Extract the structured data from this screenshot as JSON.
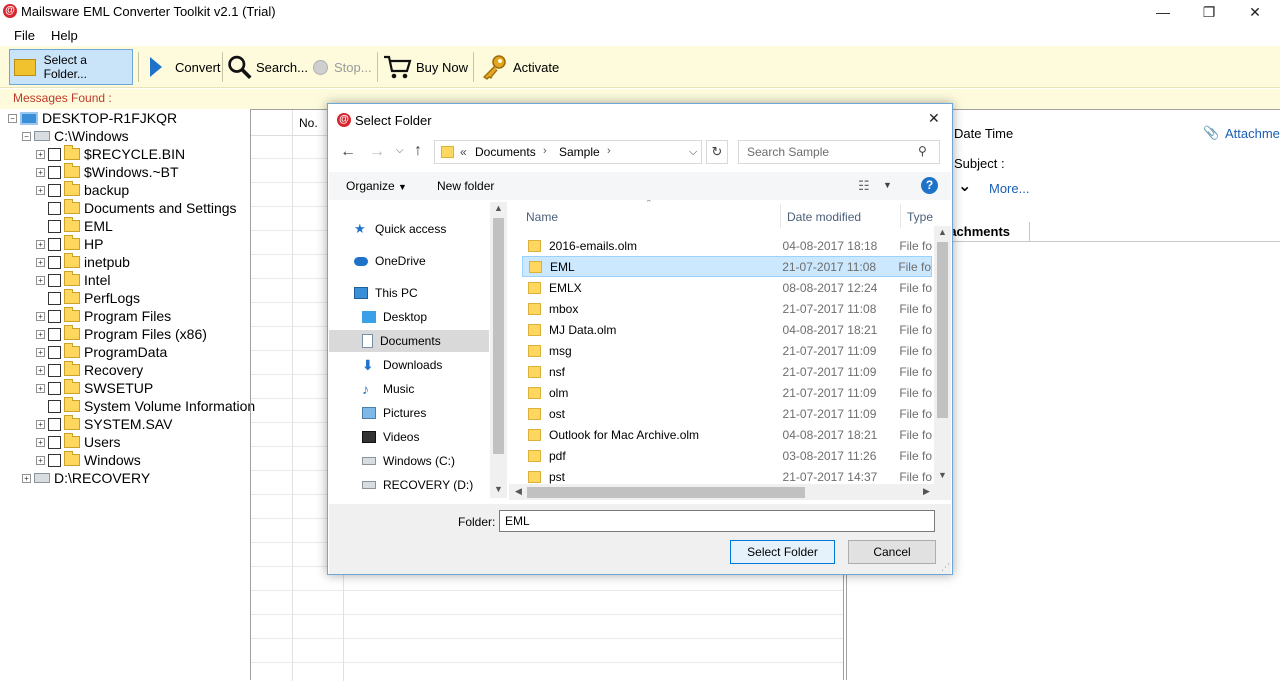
{
  "window": {
    "title": "Mailsware EML Converter Toolkit v2.1 (Trial)",
    "logo_glyph": "@",
    "minimize": "—",
    "maximize": "❐",
    "close": "✕"
  },
  "menu": {
    "file": "File",
    "help": "Help"
  },
  "toolbar": {
    "select_folder": "Select a Folder...",
    "convert": "Convert",
    "search": "Search...",
    "stop": "Stop...",
    "buy_now": "Buy Now",
    "activate": "Activate"
  },
  "messages_found": "Messages Found :",
  "tree": {
    "root": "DESKTOP-R1FJKQR",
    "drive_c": "C:\\Windows",
    "folders": [
      {
        "label": "$RECYCLE.BIN",
        "expandable": true
      },
      {
        "label": "$Windows.~BT",
        "expandable": true
      },
      {
        "label": "backup",
        "expandable": true
      },
      {
        "label": "Documents and Settings",
        "expandable": false
      },
      {
        "label": "EML",
        "expandable": false
      },
      {
        "label": "HP",
        "expandable": true
      },
      {
        "label": "inetpub",
        "expandable": true
      },
      {
        "label": "Intel",
        "expandable": true
      },
      {
        "label": "PerfLogs",
        "expandable": false
      },
      {
        "label": "Program Files",
        "expandable": true
      },
      {
        "label": "Program Files (x86)",
        "expandable": true
      },
      {
        "label": "ProgramData",
        "expandable": true
      },
      {
        "label": "Recovery",
        "expandable": true
      },
      {
        "label": "SWSETUP",
        "expandable": true
      },
      {
        "label": "System Volume Information",
        "expandable": false
      },
      {
        "label": "SYSTEM.SAV",
        "expandable": true
      },
      {
        "label": "Users",
        "expandable": true
      },
      {
        "label": "Windows",
        "expandable": true
      }
    ],
    "drive_d": "D:\\RECOVERY"
  },
  "grid": {
    "col_no": "No."
  },
  "preview": {
    "date_time": "Date Time",
    "attachments_short": "Attachme",
    "subject": "Subject :",
    "more": "More...",
    "attachments_tab": "tachments"
  },
  "dialog": {
    "title": "Select Folder",
    "breadcrumb_prefix": "«",
    "breadcrumb_1": "Documents",
    "breadcrumb_2": "Sample",
    "search_placeholder": "Search Sample",
    "organize": "Organize",
    "new_folder": "New folder",
    "help": "?",
    "nav": {
      "quick_access": "Quick access",
      "onedrive": "OneDrive",
      "this_pc": "This PC",
      "desktop": "Desktop",
      "documents": "Documents",
      "downloads": "Downloads",
      "music": "Music",
      "pictures": "Pictures",
      "videos": "Videos",
      "windows_c": "Windows (C:)",
      "recovery_d": "RECOVERY (D:)"
    },
    "columns": {
      "name": "Name",
      "date_modified": "Date modified",
      "type": "Type"
    },
    "files": [
      {
        "name": "2016-emails.olm",
        "date": "04-08-2017 18:18",
        "type": "File fo"
      },
      {
        "name": "EML",
        "date": "21-07-2017 11:08",
        "type": "File fo",
        "selected": true
      },
      {
        "name": "EMLX",
        "date": "08-08-2017 12:24",
        "type": "File fo"
      },
      {
        "name": "mbox",
        "date": "21-07-2017 11:08",
        "type": "File fo"
      },
      {
        "name": "MJ Data.olm",
        "date": "04-08-2017 18:21",
        "type": "File fo"
      },
      {
        "name": "msg",
        "date": "21-07-2017 11:09",
        "type": "File fo"
      },
      {
        "name": "nsf",
        "date": "21-07-2017 11:09",
        "type": "File fo"
      },
      {
        "name": "olm",
        "date": "21-07-2017 11:09",
        "type": "File fo"
      },
      {
        "name": "ost",
        "date": "21-07-2017 11:09",
        "type": "File fo"
      },
      {
        "name": "Outlook for Mac Archive.olm",
        "date": "04-08-2017 18:21",
        "type": "File fo"
      },
      {
        "name": "pdf",
        "date": "03-08-2017 11:26",
        "type": "File fo"
      },
      {
        "name": "pst",
        "date": "21-07-2017 14:37",
        "type": "File fo"
      }
    ],
    "folder_label": "Folder:",
    "folder_value": "EML",
    "select_button": "Select Folder",
    "cancel_button": "Cancel"
  },
  "colors": {
    "toolbar_bg": "#fdfbdc",
    "selected_blue": "#cce8ff",
    "link_blue": "#1a5fb4",
    "messages_red": "#c0392b"
  }
}
